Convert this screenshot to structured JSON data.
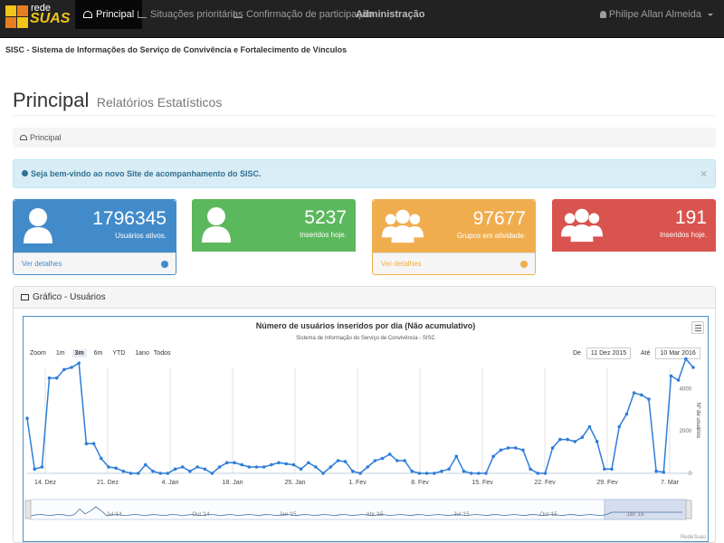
{
  "nav": {
    "brand_top": "rede",
    "brand_bottom": "SUAS",
    "items": [
      {
        "label": "Principal",
        "active": true
      },
      {
        "label": "Situações prioritárias",
        "active": false
      },
      {
        "label": "Confirmação de participação",
        "active": false
      },
      {
        "label": "Administração",
        "active": false
      }
    ],
    "user": "Philipe Allan Almeida"
  },
  "subtitle": "SISC - Sistema de Informações do Serviço de Convivência e Fortalecimento de Vínculos",
  "header": {
    "title": "Principal",
    "subtitle": "Relatórios Estatísticos"
  },
  "breadcrumb": "Principal",
  "alert": {
    "text": "Seja bem-vindo ao novo Site de acompanhamento do SISC.",
    "close": "×"
  },
  "panels": [
    {
      "value": "1796345",
      "label": "Usuários ativos.",
      "link": "Ver detalhes",
      "color": "#428bca"
    },
    {
      "value": "5237",
      "label": "Inseridos hoje.",
      "link": "",
      "color": "#5cb85c"
    },
    {
      "value": "97677",
      "label": "Grupos em atividade.",
      "link": "Ver detalhes",
      "color": "#f0ad4e"
    },
    {
      "value": "191",
      "label": "Inseridos hoje.",
      "link": "",
      "color": "#d9534f"
    }
  ],
  "chart_panel": {
    "title": "Gráfico - Usuários"
  },
  "chart_controls": {
    "zoom_label": "Zoom",
    "zoom_options": [
      "1m",
      "3m",
      "6m",
      "YTD",
      "1ano",
      "Todos"
    ],
    "zoom_selected": "3m",
    "from_label": "De",
    "from_value": "11 Dez 2015",
    "to_label": "Até",
    "to_value": "10 Mar 2016",
    "credits": "RedeSuas"
  },
  "chart_data": {
    "type": "line",
    "title": "Número de usuários inseridos por dia (Não acumulativo)",
    "subtitle": "Sistema de Informação do Serviço de Convivência - SISC",
    "ylabel": "Nº de usuários",
    "ylim": [
      0,
      5000
    ],
    "y_ticks": [
      0,
      2000,
      4000
    ],
    "x_ticks": [
      "14. Dez",
      "21. Dez",
      "4. Jan",
      "18. Jan",
      "25. Jan",
      "1. Fev",
      "8. Fev",
      "15. Fev",
      "22. Fev",
      "29. Fev",
      "7. Mar"
    ],
    "navigator_ticks": [
      "Jul '14",
      "Out '14",
      "Jan '15",
      "Abr '15",
      "Jul '15",
      "Out '15",
      "Jan '16"
    ],
    "series": [
      {
        "color": "#2f7ed8",
        "values": [
          2600,
          200,
          300,
          4500,
          4500,
          4900,
          5000,
          5200,
          1400,
          1400,
          700,
          300,
          250,
          100,
          0,
          0,
          400,
          100,
          0,
          0,
          200,
          300,
          100,
          300,
          200,
          0,
          300,
          500,
          500,
          400,
          300,
          300,
          300,
          400,
          500,
          450,
          400,
          200,
          500,
          300,
          0,
          300,
          600,
          550,
          100,
          0,
          300,
          600,
          700,
          900,
          600,
          600,
          100,
          0,
          0,
          0,
          100,
          200,
          800,
          100,
          0,
          0,
          0,
          800,
          1100,
          1200,
          1200,
          1100,
          200,
          0,
          0,
          1200,
          1600,
          1600,
          1500,
          1700,
          2200,
          1500,
          200,
          200,
          2200,
          2800,
          3800,
          3700,
          3500,
          100,
          50,
          4600,
          4400,
          5400,
          5000
        ]
      }
    ]
  }
}
